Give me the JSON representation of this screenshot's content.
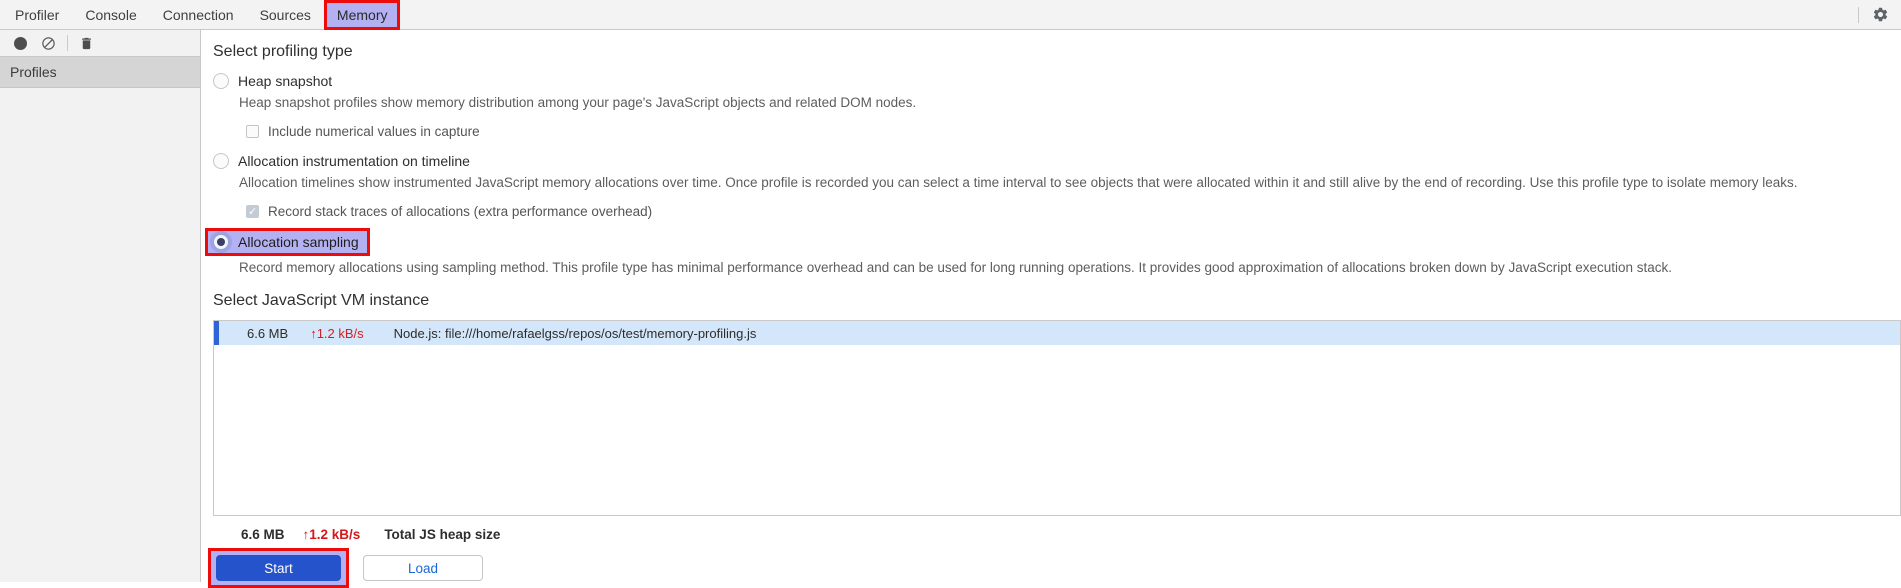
{
  "colors": {
    "annotation_red": "#ee0b0b",
    "annotation_lavender": "#b4b1f2",
    "start_button_blue": "#2553cc",
    "selected_row_blue": "#d4e6f9",
    "row_accent_blue": "#2f64d6",
    "rate_red": "#d42020",
    "load_text_blue": "#1a66d9"
  },
  "tabbar": {
    "tabs": [
      {
        "label": "Profiler"
      },
      {
        "label": "Console"
      },
      {
        "label": "Connection"
      },
      {
        "label": "Sources"
      },
      {
        "label": "Memory"
      }
    ],
    "active_tab": "Memory"
  },
  "toolbar": {
    "icons": [
      "record-icon",
      "block-icon",
      "trash-icon"
    ]
  },
  "sidebar": {
    "header": "Profiles"
  },
  "profiling": {
    "heading": "Select profiling type",
    "options": [
      {
        "label": "Heap snapshot",
        "desc": "Heap snapshot profiles show memory distribution among your page's JavaScript objects and related DOM nodes.",
        "selected": false,
        "sub": {
          "label": "Include numerical values in capture",
          "checked": false
        }
      },
      {
        "label": "Allocation instrumentation on timeline",
        "desc": "Allocation timelines show instrumented JavaScript memory allocations over time. Once profile is recorded you can select a time interval to see objects that were allocated within it and still alive by the end of recording. Use this profile type to isolate memory leaks.",
        "selected": false,
        "sub": {
          "label": "Record stack traces of allocations (extra performance overhead)",
          "checked": true
        }
      },
      {
        "label": "Allocation sampling",
        "desc": "Record memory allocations using sampling method. This profile type has minimal performance overhead and can be used for long running operations. It provides good approximation of allocations broken down by JavaScript execution stack.",
        "selected": true
      }
    ]
  },
  "vm": {
    "heading": "Select JavaScript VM instance",
    "rows": [
      {
        "size": "6.6 MB",
        "rate": "↑1.2 kB/s",
        "name": "Node.js: file:///home/rafaelgss/repos/os/test/memory-profiling.js"
      }
    ]
  },
  "footer": {
    "total_size": "6.6 MB",
    "total_rate": "↑1.2 kB/s",
    "total_label": "Total JS heap size",
    "start_label": "Start",
    "load_label": "Load"
  }
}
